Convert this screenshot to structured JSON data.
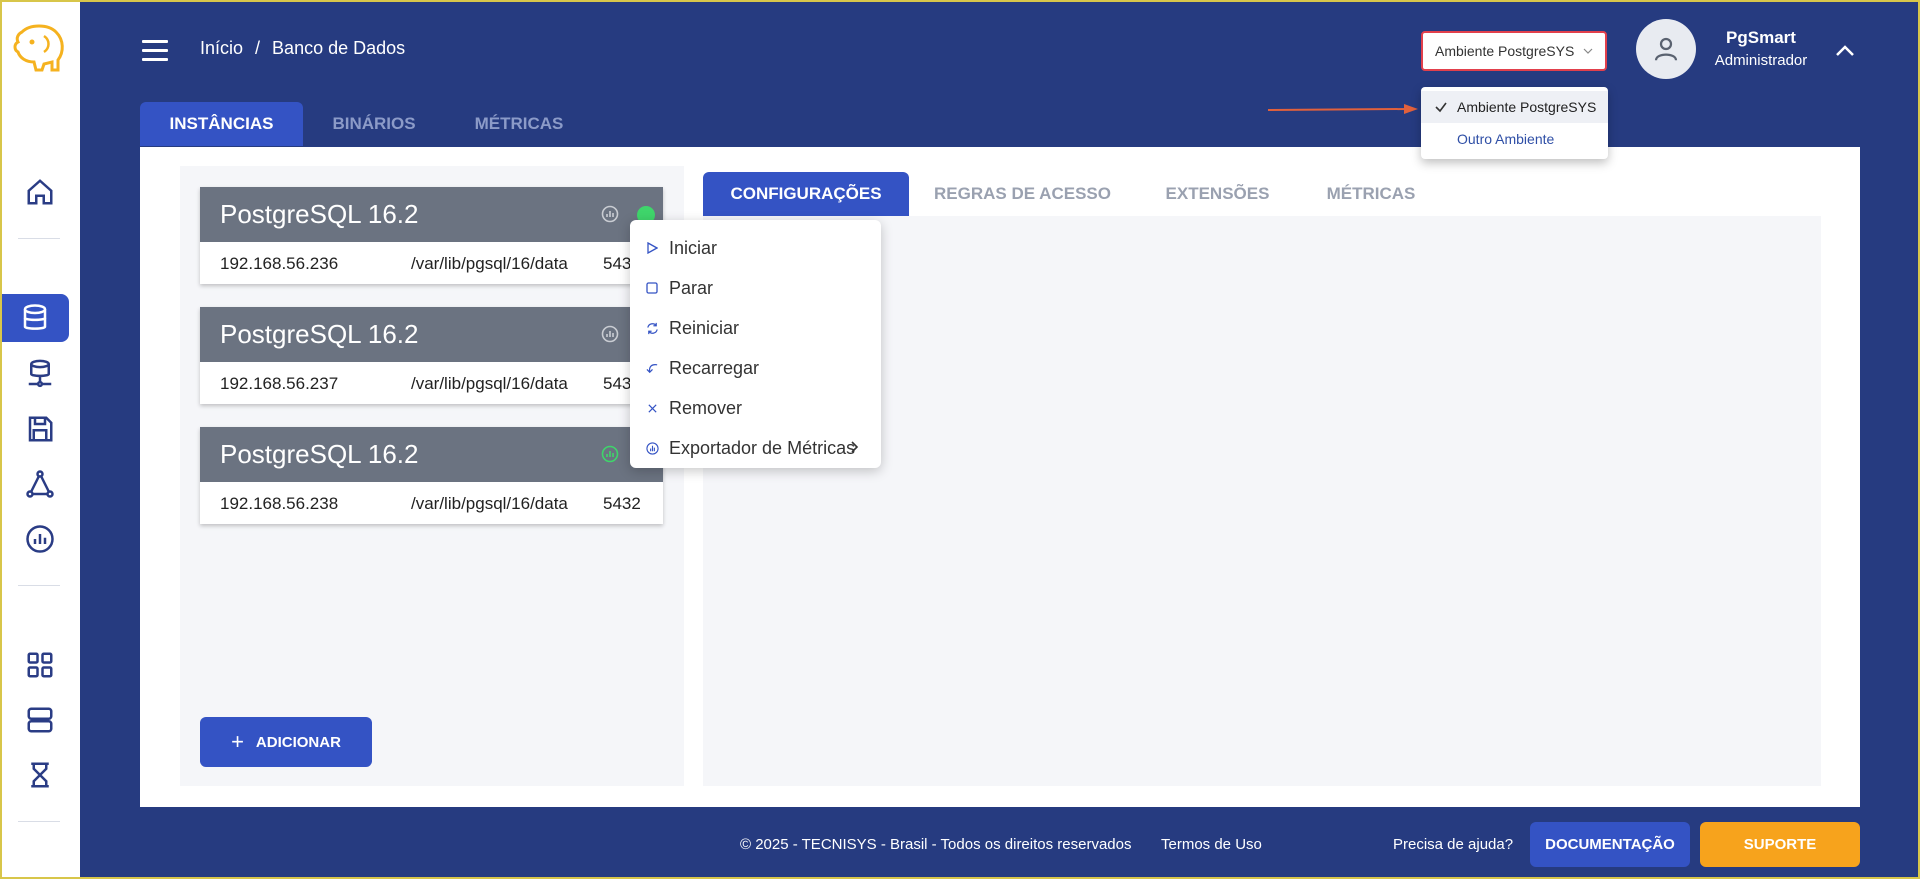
{
  "header": {
    "breadcrumb": [
      "Início",
      "/",
      "Banco de Dados"
    ],
    "environment": {
      "selected": "Ambiente PostgreSYS",
      "options": [
        "Ambiente PostgreSYS",
        "Outro Ambiente"
      ]
    },
    "user": {
      "name": "PgSmart",
      "role": "Administrador"
    }
  },
  "main_tabs": [
    "INSTÂNCIAS",
    "BINÁRIOS",
    "MÉTRICAS"
  ],
  "instances": [
    {
      "name": "PostgreSQL 16.2",
      "ip": "192.168.56.236",
      "path": "/var/lib/pgsql/16/data",
      "port": "543"
    },
    {
      "name": "PostgreSQL 16.2",
      "ip": "192.168.56.237",
      "path": "/var/lib/pgsql/16/data",
      "port": "543"
    },
    {
      "name": "PostgreSQL 16.2",
      "ip": "192.168.56.238",
      "path": "/var/lib/pgsql/16/data",
      "port": "5432"
    }
  ],
  "add_button": "ADICIONAR",
  "context_menu": [
    "Iniciar",
    "Parar",
    "Reiniciar",
    "Recarregar",
    "Remover",
    "Exportador de Métricas"
  ],
  "sub_tabs": [
    "CONFIGURAÇÕES",
    "REGRAS DE ACESSO",
    "EXTENSÕES",
    "MÉTRICAS"
  ],
  "footer": {
    "copyright": "© 2025 - TECNISYS - Brasil - Todos os direitos reservados",
    "terms": "Termos de Uso",
    "help": "Precisa de ajuda?",
    "doc_button": "DOCUMENTAÇÃO",
    "support_button": "SUPORTE"
  },
  "colors": {
    "background": "#263b80",
    "primary": "#3453c4",
    "support": "#f7a31c",
    "status_online": "#3fd56b",
    "card_header": "#6b7381",
    "logo": "#f5b21f"
  },
  "icons": [
    "menu-icon",
    "home-icon",
    "database-icon",
    "server-network-icon",
    "save-icon",
    "cluster-icon",
    "chart-icon",
    "grid-icon",
    "servers-icon",
    "hourglass-icon",
    "user-icon",
    "chevron-up-icon",
    "chevron-down-icon",
    "check-icon",
    "plus-icon",
    "play-icon",
    "stop-icon",
    "refresh-icon",
    "reload-icon",
    "close-icon",
    "chart-icon",
    "chevron-right-icon"
  ]
}
